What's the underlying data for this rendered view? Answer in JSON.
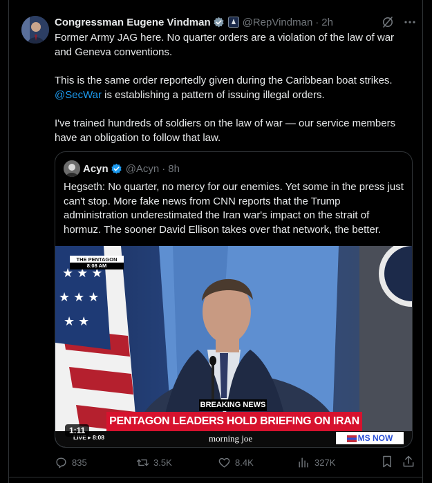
{
  "tweet": {
    "author_name": "Congressman Eugene Vindman",
    "handle": "@RepVindman",
    "separator": "·",
    "time": "2h",
    "paragraphs": [
      {
        "parts": [
          {
            "text": "Former Army JAG here. No quarter orders are a violation of the law of war and Geneva conventions.",
            "mention": false
          }
        ]
      },
      {
        "parts": [
          {
            "text": "This is the same order reportedly given during the Caribbean boat strikes. ",
            "mention": false
          },
          {
            "text": "@SecWar",
            "mention": true
          },
          {
            "text": " is establishing a pattern of issuing illegal orders.",
            "mention": false
          }
        ]
      },
      {
        "parts": [
          {
            "text": "I've trained hundreds of soldiers on the law of war — our service members have an obligation to follow that law.",
            "mention": false
          }
        ]
      }
    ],
    "icons": {
      "verified": "verified-badge-icon",
      "affiliation": "government-affiliate-icon",
      "grok": "grok-icon",
      "more": "more-icon"
    }
  },
  "quote": {
    "author_name": "Acyn",
    "handle": "@Acyn",
    "separator": "·",
    "time": "8h",
    "text": "Hegseth: No quarter, no mercy for our enemies. Yet some in the press just can't stop. More fake news from CNN reports that the Trump administration underestimated the Iran war's impact on the strait of hormuz. The sooner David Ellison takes over that network, the better.",
    "video": {
      "bug_line1": "THE PENTAGON",
      "bug_line2": "8:08 AM",
      "breaking": "BREAKING NEWS",
      "headline": "PENTAGON LEADERS HOLD BRIEFING ON IRAN WAR",
      "live_text": "LIVE",
      "live_time": "8:08",
      "show": "morning joe",
      "network": "MS NOW",
      "duration": "1:11"
    }
  },
  "actions": {
    "replies": "835",
    "reposts": "3.5K",
    "likes": "8.4K",
    "views": "327K",
    "icons": [
      "reply-icon",
      "repost-icon",
      "like-icon",
      "views-icon",
      "bookmark-icon",
      "share-icon"
    ]
  },
  "colors": {
    "background": "#000000",
    "text": "#e7e9ea",
    "muted": "#71767b",
    "accent": "#1d9bf0",
    "border": "#2f3336",
    "headline_red": "#d7122e"
  }
}
